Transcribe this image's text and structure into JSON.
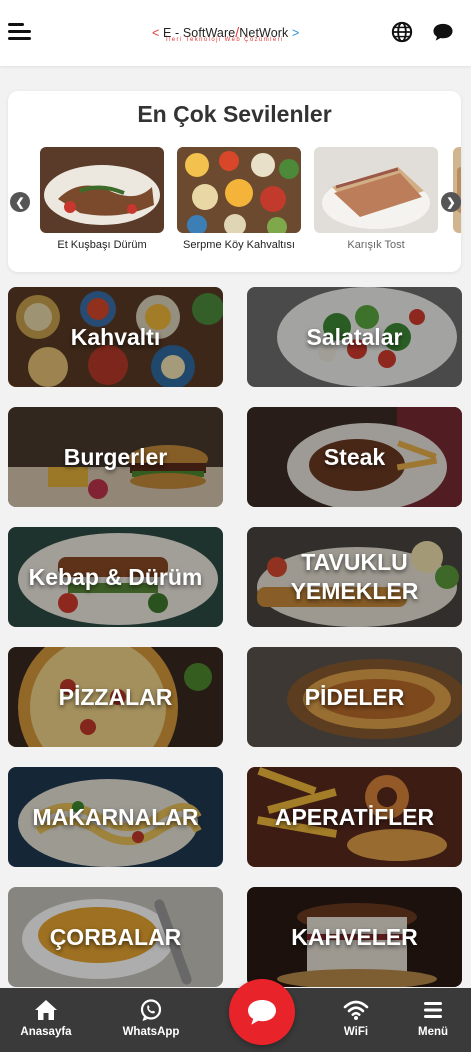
{
  "header": {
    "logo_lt": "<",
    "logo_name_a": "E - SoftWare",
    "logo_slash": "/",
    "logo_name_b": "NetWork",
    "logo_gt": ">",
    "logo_tagline": "İleri Teknoloji Web Çözümleri",
    "icons": [
      "menu-icon",
      "globe-icon",
      "chat-icon"
    ]
  },
  "favorites": {
    "title": "En Çok Sevilenler",
    "prev_icon": "chevron-left-icon",
    "next_icon": "chevron-right-icon",
    "items": [
      {
        "label": "Et Kuşbaşı Dürüm"
      },
      {
        "label": "Serpme Köy Kahvaltısı"
      },
      {
        "label": "Karışık Tost"
      }
    ]
  },
  "categories": [
    {
      "label": "Kahvaltı"
    },
    {
      "label": "Salatalar"
    },
    {
      "label": "Burgerler"
    },
    {
      "label": "Steak"
    },
    {
      "label": "Kebap & Dürüm"
    },
    {
      "label": "TAVUKLU YEMEKLER"
    },
    {
      "label": "PİZZALAR"
    },
    {
      "label": "PİDELER"
    },
    {
      "label": "MAKARNALAR"
    },
    {
      "label": "APERATİFLER"
    },
    {
      "label": "ÇORBALAR"
    },
    {
      "label": "KAHVELER"
    }
  ],
  "bottom_nav": {
    "home": "Anasayfa",
    "whatsapp": "WhatsApp",
    "wifi": "WiFi",
    "menu": "Menü",
    "center_icon": "chat-bubble-icon"
  },
  "colors": {
    "accent_red": "#e8232a",
    "nav_bg": "#3a3a3a",
    "logo_blue": "#2b8fd8"
  }
}
